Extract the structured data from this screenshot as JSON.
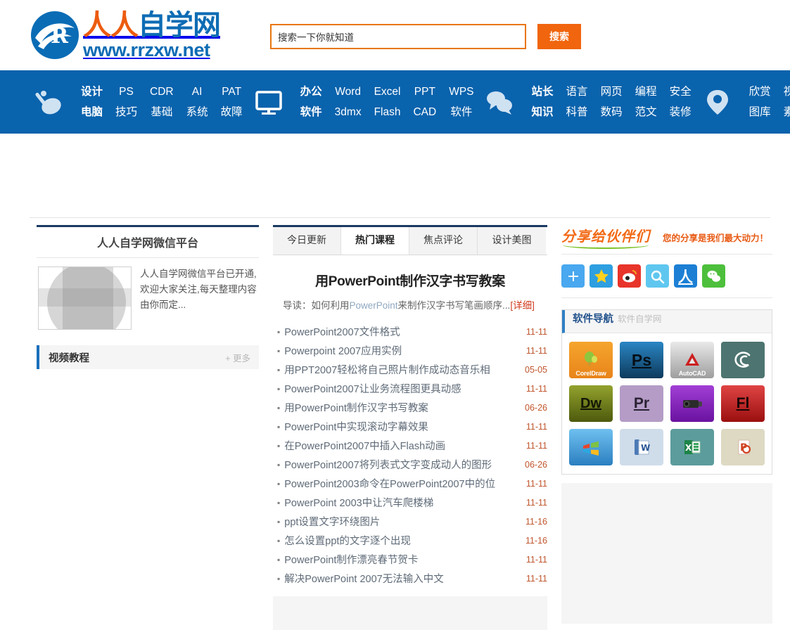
{
  "site": {
    "logo_cn_part1": "人人",
    "logo_cn_part2": "自学网",
    "logo_url": "www.rrzxw.net"
  },
  "search": {
    "value": "搜索一下你就知道",
    "placeholder": "搜索一下你就知道",
    "button_label": "搜索"
  },
  "nav": {
    "groups": [
      {
        "icon": "satellite-dish-icon",
        "columns": [
          {
            "top": "设计",
            "bottom": "电脑",
            "bold": true
          },
          {
            "top": "PS",
            "bottom": "技巧",
            "bold": false
          },
          {
            "top": "CDR",
            "bottom": "基础",
            "bold": false
          },
          {
            "top": "AI",
            "bottom": "系统",
            "bold": false
          },
          {
            "top": "PAT",
            "bottom": "故障",
            "bold": false
          }
        ]
      },
      {
        "icon": "monitor-icon",
        "columns": [
          {
            "top": "办公",
            "bottom": "软件",
            "bold": true
          },
          {
            "top": "Word",
            "bottom": "3dmx",
            "bold": false
          },
          {
            "top": "Excel",
            "bottom": "Flash",
            "bold": false
          },
          {
            "top": "PPT",
            "bottom": "CAD",
            "bold": false
          },
          {
            "top": "WPS",
            "bottom": "软件",
            "bold": false
          }
        ]
      },
      {
        "icon": "chat-bubbles-icon",
        "columns": [
          {
            "top": "站长",
            "bottom": "知识",
            "bold": true
          },
          {
            "top": "语言",
            "bottom": "科普",
            "bold": false
          },
          {
            "top": "网页",
            "bottom": "数码",
            "bold": false
          },
          {
            "top": "编程",
            "bottom": "范文",
            "bold": false
          },
          {
            "top": "安全",
            "bottom": "装修",
            "bold": false
          }
        ]
      },
      {
        "icon": "map-pin-icon",
        "columns": [
          {
            "top": "欣赏",
            "bottom": "图库",
            "bold": false
          },
          {
            "top": "视频",
            "bottom": "素材",
            "bold": false
          }
        ]
      }
    ]
  },
  "left": {
    "wechat_title": "人人自学网微信平台",
    "wechat_desc": "人人自学网微信平台已开通,欢迎大家关注,每天整理内容由你而定...",
    "video_section_title": "视频教程",
    "video_more_label": "+ 更多"
  },
  "middle": {
    "tabs": [
      {
        "label": "今日更新",
        "active": false
      },
      {
        "label": "热门课程",
        "active": true
      },
      {
        "label": "焦点评论",
        "active": false
      },
      {
        "label": "设计美图",
        "active": false
      }
    ],
    "headline": "用PowerPoint制作汉字书写教案",
    "lead_prefix": "导读：如何利用",
    "lead_keyword": "PowerPoint",
    "lead_suffix": "来制作汉字书写笔画顺序...",
    "lead_more": "[详细]",
    "articles": [
      {
        "title": "PowerPoint2007文件格式",
        "date": "11-11"
      },
      {
        "title": "Powerpoint 2007应用实例",
        "date": "11-11"
      },
      {
        "title": "用PPT2007轻松将自己照片制作成动态音乐相",
        "date": "05-05"
      },
      {
        "title": "PowerPoint2007让业务流程图更具动感",
        "date": "11-11"
      },
      {
        "title": "用PowerPoint制作汉字书写教案",
        "date": "06-26"
      },
      {
        "title": "PowerPoint中实现滚动字幕效果",
        "date": "11-11"
      },
      {
        "title": "在PowerPoint2007中插入Flash动画",
        "date": "11-11"
      },
      {
        "title": "PowerPoint2007将列表式文字变成动人的图形",
        "date": "06-26"
      },
      {
        "title": "PowerPoint2003命令在PowerPoint2007中的位",
        "date": "11-11"
      },
      {
        "title": "PowerPoint 2003中让汽车爬楼梯",
        "date": "11-11"
      },
      {
        "title": "ppt设置文字环绕图片",
        "date": "11-16"
      },
      {
        "title": "怎么设置ppt的文字逐个出现",
        "date": "11-16"
      },
      {
        "title": "PowerPoint制作漂亮春节贺卡",
        "date": "11-11"
      },
      {
        "title": "解决PowerPoint 2007无法输入中文",
        "date": "11-11"
      }
    ]
  },
  "right": {
    "share_title": "分享给伙伴们",
    "share_subtitle": "您的分享是我们最大动力！",
    "share_icons": [
      {
        "name": "share-plus-icon",
        "glyph": "+",
        "color": "#49a8ef",
        "fg": "#ffffff"
      },
      {
        "name": "qzone-star-icon",
        "glyph": "★",
        "color": "#2e9fe0",
        "fg": "#ffd21e"
      },
      {
        "name": "weibo-icon",
        "glyph": "◉",
        "color": "#e8342a",
        "fg": "#ffffff"
      },
      {
        "name": "baidu-tieba-icon",
        "glyph": "Q",
        "color": "#5fc7ef",
        "fg": "#ffffff"
      },
      {
        "name": "renren-icon",
        "glyph": "人",
        "color": "#1c7fd4",
        "fg": "#ffffff"
      },
      {
        "name": "wechat-icon",
        "glyph": "◕",
        "color": "#4dbf3c",
        "fg": "#ffffff"
      }
    ],
    "soft_nav_title": "软件导航",
    "soft_nav_subtitle": "软件自学网",
    "soft_items": [
      {
        "name": "coreldraw-icon",
        "label": "CorelDraw",
        "glyph": "",
        "bg": "#f0931e",
        "fg": "#ffffff",
        "label_color": "#ffffff"
      },
      {
        "name": "photoshop-icon",
        "label": "",
        "glyph": "Ps",
        "bg": "#1b4f7a",
        "fg": "#0c0c0c",
        "label_color": "#ffffff"
      },
      {
        "name": "autocad-icon",
        "label": "AutoCAD",
        "glyph": "A",
        "bg": "#b9b9b9",
        "fg": "#cc1f1f",
        "label_color": "#ffffff"
      },
      {
        "name": "cinema-swish-icon",
        "label": "",
        "glyph": "G",
        "bg": "#4d7470",
        "fg": "#ffffff",
        "label_color": "#ffffff"
      },
      {
        "name": "dreamweaver-icon",
        "label": "",
        "glyph": "Dw",
        "bg": "#6d7a18",
        "fg": "#1b1b1b",
        "label_color": "#ffffff"
      },
      {
        "name": "premiere-icon",
        "label": "",
        "glyph": "Pr",
        "bg": "#b49cc6",
        "fg": "#2a2133",
        "label_color": "#ffffff"
      },
      {
        "name": "camcorder-icon",
        "label": "",
        "glyph": "▤",
        "bg": "#8f2fc4",
        "fg": "#2b2b2b",
        "label_color": "#ffffff"
      },
      {
        "name": "flash-icon",
        "label": "",
        "glyph": "Fl",
        "bg": "#c62020",
        "fg": "#1a0505",
        "label_color": "#ffffff"
      },
      {
        "name": "windows-icon",
        "label": "",
        "glyph": "⊞",
        "bg": "#4a9fe0",
        "fg": "#ffffff",
        "label_color": "#ffffff"
      },
      {
        "name": "word-icon",
        "label": "",
        "glyph": "W",
        "bg": "#c6d4e6",
        "fg": "#2b5797",
        "label_color": "#ffffff"
      },
      {
        "name": "excel-icon",
        "label": "",
        "glyph": "X",
        "bg": "#5c9c9c",
        "fg": "#217346",
        "label_color": "#ffffff"
      },
      {
        "name": "powerpoint-icon",
        "label": "",
        "glyph": "P",
        "bg": "#ddd9c3",
        "fg": "#d04423",
        "label_color": "#ffffff"
      }
    ]
  }
}
